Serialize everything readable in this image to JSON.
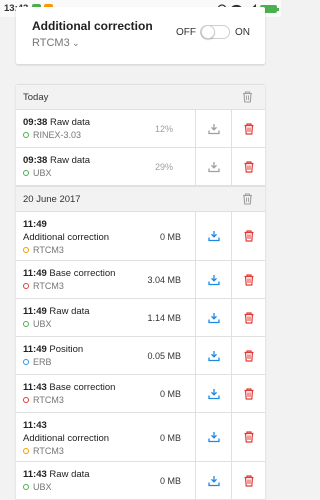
{
  "status_bar": {
    "time": "13:43"
  },
  "header_card": {
    "title": "Additional correction",
    "selected": "RTCM3",
    "off_label": "OFF",
    "on_label": "ON",
    "toggle_on": false
  },
  "groups": [
    {
      "label": "Today",
      "rows": [
        {
          "time": "09:38",
          "title": "Raw data",
          "type": "RINEX-3.03",
          "value": "12%",
          "dot": "#4caf50",
          "done": true
        },
        {
          "time": "09:38",
          "title": "Raw data",
          "type": "UBX",
          "value": "29%",
          "dot": "#4caf50",
          "done": true
        }
      ]
    },
    {
      "label": "20 June 2017",
      "rows": [
        {
          "time": "11:49",
          "title": "Additional correction",
          "type": "RTCM3",
          "value": "0 MB",
          "dot": "#ff9800",
          "done": false
        },
        {
          "time": "11:49",
          "title": "Base correction",
          "type": "RTCM3",
          "value": "3.04 MB",
          "dot": "#e53935",
          "done": false
        },
        {
          "time": "11:49",
          "title": "Raw data",
          "type": "UBX",
          "value": "1.14 MB",
          "dot": "#4caf50",
          "done": false
        },
        {
          "time": "11:49",
          "title": "Position",
          "type": "ERB",
          "value": "0.05 MB",
          "dot": "#2196f3",
          "done": false
        },
        {
          "time": "11:43",
          "title": "Base correction",
          "type": "RTCM3",
          "value": "0 MB",
          "dot": "#e53935",
          "done": false
        },
        {
          "time": "11:43",
          "title": "Additional correction",
          "type": "RTCM3",
          "value": "0 MB",
          "dot": "#ff9800",
          "done": false
        },
        {
          "time": "11:43",
          "title": "Raw data",
          "type": "UBX",
          "value": "0 MB",
          "dot": "#4caf50",
          "done": false
        }
      ]
    }
  ],
  "colors": {
    "accent_blue": "#1e88e5",
    "delete_red": "#e53935",
    "grey_icon": "#9e9e9e"
  }
}
